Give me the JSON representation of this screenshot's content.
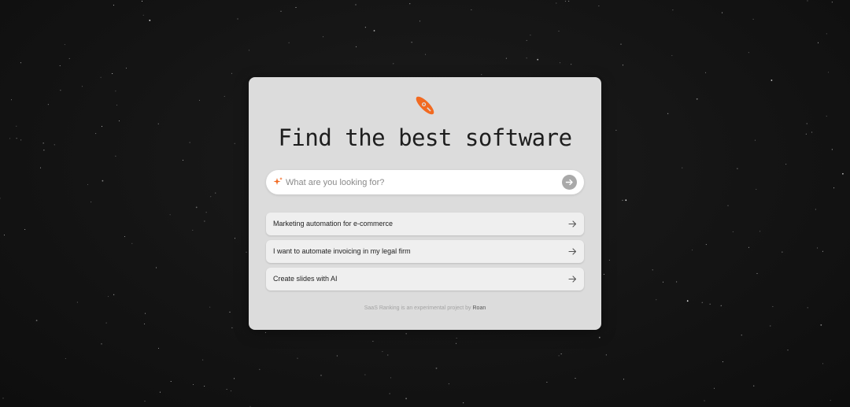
{
  "colors": {
    "accent": "#f26a21",
    "card_bg": "#dcdcdc",
    "background": "#121212"
  },
  "logo": {
    "icon": "rocket-logo-icon"
  },
  "title": "Find the best software",
  "search": {
    "icon": "sparkle-icon",
    "placeholder": "What are you looking for?",
    "value": "",
    "submit_icon": "arrow-right-icon"
  },
  "suggestions": [
    {
      "label": "Marketing automation for e-commerce",
      "icon": "arrow-right-icon"
    },
    {
      "label": "I want to automate invoicing in my legal firm",
      "icon": "arrow-right-icon"
    },
    {
      "label": "Create slides with AI",
      "icon": "arrow-right-icon"
    }
  ],
  "footer": {
    "text": "SaaS Ranking is an experimental project by ",
    "link": "Roan"
  }
}
